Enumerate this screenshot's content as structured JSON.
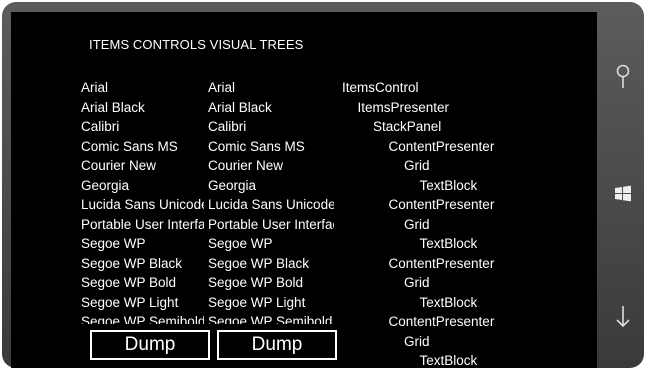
{
  "header": {
    "title": "ITEMS CONTROLS VISUAL TREES"
  },
  "fonts_list_1": [
    "Arial",
    "Arial Black",
    "Calibri",
    "Comic Sans MS",
    "Courier New",
    "Georgia",
    "Lucida Sans Unicode",
    "Portable User Interface",
    "Segoe WP",
    "Segoe WP Black",
    "Segoe WP Bold",
    "Segoe WP Light",
    "Segoe WP Semibold"
  ],
  "fonts_list_2": [
    "Arial",
    "Arial Black",
    "Calibri",
    "Comic Sans MS",
    "Courier New",
    "Georgia",
    "Lucida Sans Unicode",
    "Portable User Interface",
    "Segoe WP",
    "Segoe WP Black",
    "Segoe WP Bold",
    "Segoe WP Light",
    "Segoe WP Semibold"
  ],
  "visual_tree": [
    {
      "text": "ItemsControl",
      "depth": 0
    },
    {
      "text": "ItemsPresenter",
      "depth": 1
    },
    {
      "text": "StackPanel",
      "depth": 2
    },
    {
      "text": "ContentPresenter",
      "depth": 3
    },
    {
      "text": "Grid",
      "depth": 4
    },
    {
      "text": "TextBlock",
      "depth": 5
    },
    {
      "text": "ContentPresenter",
      "depth": 3
    },
    {
      "text": "Grid",
      "depth": 4
    },
    {
      "text": "TextBlock",
      "depth": 5
    },
    {
      "text": "ContentPresenter",
      "depth": 3
    },
    {
      "text": "Grid",
      "depth": 4
    },
    {
      "text": "TextBlock",
      "depth": 5
    },
    {
      "text": "ContentPresenter",
      "depth": 3
    },
    {
      "text": "Grid",
      "depth": 4
    },
    {
      "text": "TextBlock",
      "depth": 5
    }
  ],
  "buttons": {
    "dump1_label": "Dump",
    "dump2_label": "Dump"
  },
  "hardware": {
    "search": "search-icon",
    "start": "windows-start-icon",
    "back": "back-arrow-icon"
  },
  "colors": {
    "screen": "#000000",
    "text": "#ffffff",
    "bezel": "#4a4a4a"
  }
}
